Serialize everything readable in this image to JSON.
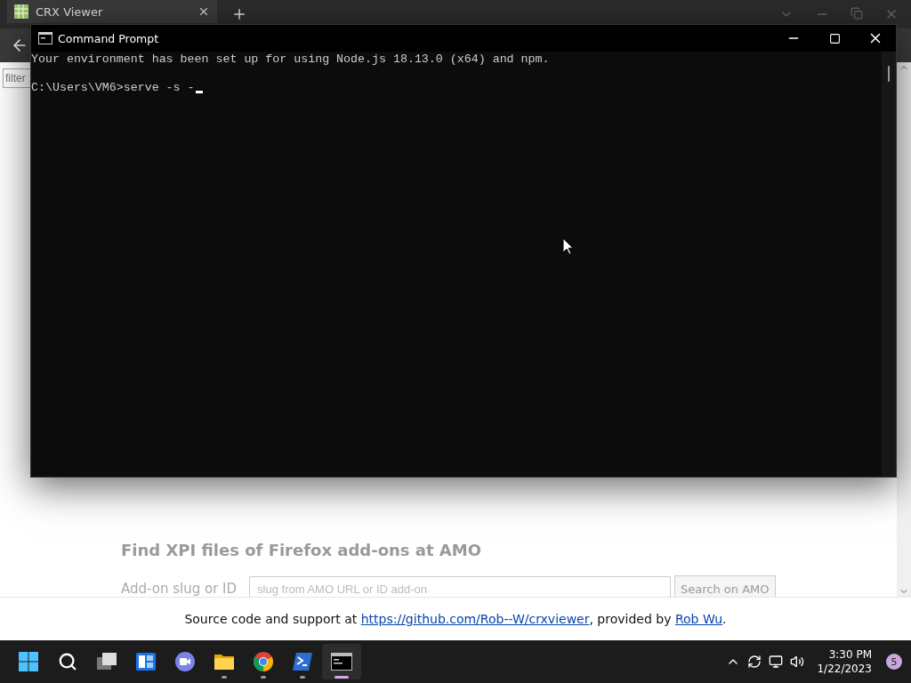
{
  "browser": {
    "tab": {
      "title": "CRX Viewer"
    },
    "filter": {
      "placeholder": "filter"
    },
    "amo_section": {
      "heading": "Find XPI files of Firefox add-ons at AMO",
      "label": "Add-on slug or ID",
      "input": {
        "placeholder": "slug from AMO URL or ID add-on"
      },
      "button": "Search on AMO"
    },
    "footer": [
      {
        "kind": "text",
        "text": "Source code and support at "
      },
      {
        "kind": "link",
        "text": "https://github.com/Rob--W/crxviewer"
      },
      {
        "kind": "text",
        "text": ", provided by "
      },
      {
        "kind": "link",
        "text": "Rob Wu"
      },
      {
        "kind": "text",
        "text": "."
      }
    ]
  },
  "console_window": {
    "title": "Command Prompt",
    "lines": [
      "Your environment has been set up for using Node.js 18.13.0 (x64) and npm.",
      "C:\\Users\\VM6>serve -s -"
    ]
  },
  "taskbar": {
    "apps": [
      {
        "kind": "start",
        "running": false,
        "selected": false
      },
      {
        "kind": "search",
        "running": false,
        "selected": false
      },
      {
        "kind": "taskview",
        "running": false,
        "selected": false
      },
      {
        "kind": "widgets",
        "running": false,
        "selected": false
      },
      {
        "kind": "chat",
        "running": false,
        "selected": false
      },
      {
        "kind": "explorer",
        "running": true,
        "selected": false
      },
      {
        "kind": "chrome",
        "running": true,
        "selected": false
      },
      {
        "kind": "powershell",
        "running": true,
        "selected": false
      },
      {
        "kind": "terminal",
        "running": true,
        "selected": true
      }
    ],
    "time": "3:30 PM",
    "date": "1/22/2023",
    "notification_count": "5"
  }
}
